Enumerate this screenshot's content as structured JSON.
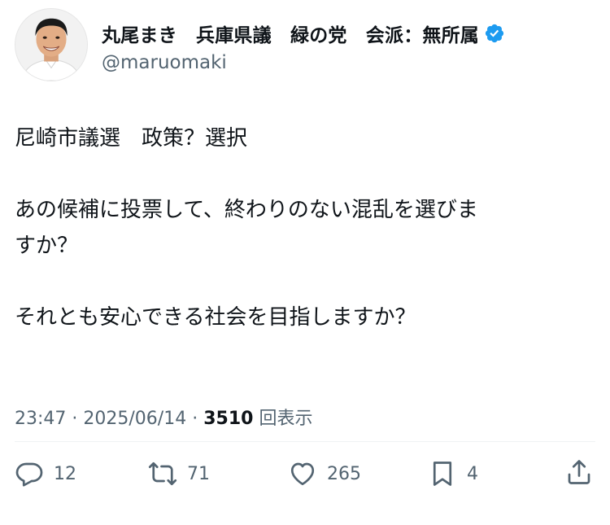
{
  "author": {
    "name": "丸尾まき　兵庫県議　緑の党　会派：無所属",
    "handle": "@maruomaki",
    "verified": true
  },
  "post": {
    "paragraphs": [
      "尼崎市議選　政策？選択",
      "あの候補に投票して、終わりのない混乱を選びま\nすか？",
      "それとも安心できる社会を目指しますか？"
    ]
  },
  "meta": {
    "time": "23:47",
    "separator": "·",
    "date": "2025/06/14",
    "views": "3510",
    "views_label": "回表示"
  },
  "actions": {
    "replies": "12",
    "reposts": "71",
    "likes": "265",
    "bookmarks": "4"
  },
  "colors": {
    "text": "#0f1419",
    "secondary": "#536471",
    "verified": "#1d9bf0"
  },
  "icons": [
    "reply-icon",
    "repost-icon",
    "like-icon",
    "bookmark-icon",
    "share-icon",
    "verified-badge-icon"
  ]
}
